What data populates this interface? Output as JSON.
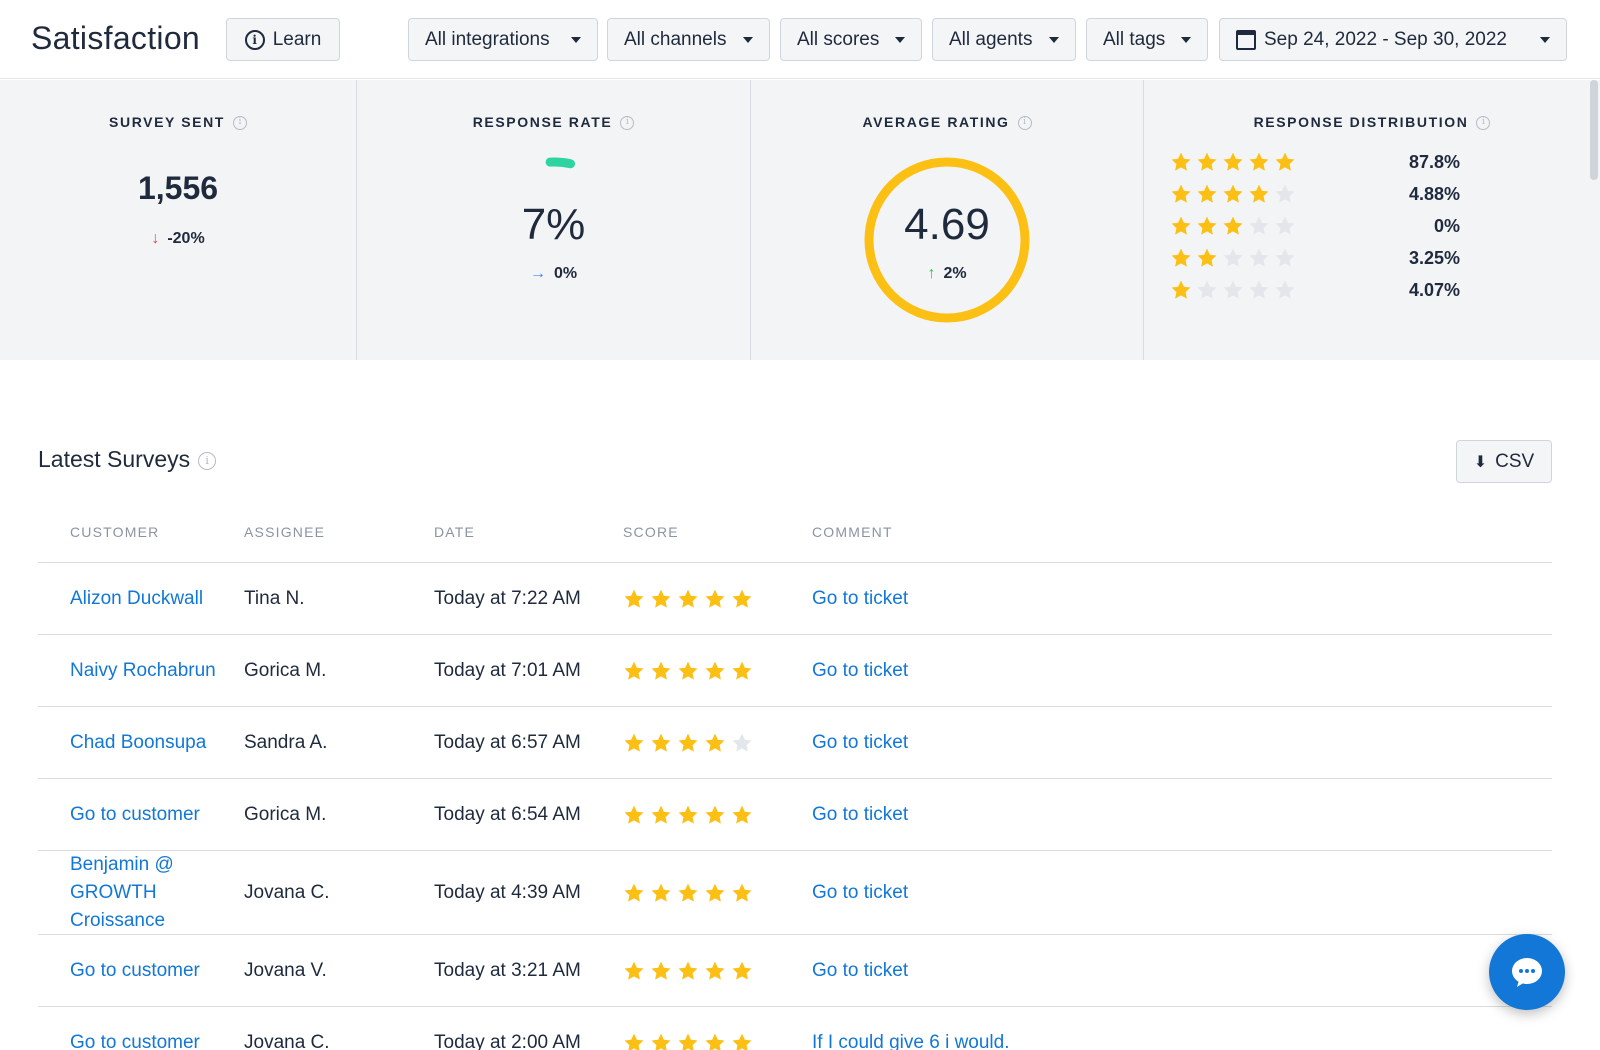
{
  "header": {
    "title": "Satisfaction",
    "learn_label": "Learn",
    "filters": [
      "All integrations",
      "All channels",
      "All scores",
      "All agents",
      "All tags"
    ],
    "date_range": "Sep 24, 2022 - Sep 30, 2022"
  },
  "stats": {
    "survey_sent": {
      "label": "SURVEY SENT",
      "value": "1,556",
      "delta": "-20%",
      "direction": "down"
    },
    "response_rate": {
      "label": "RESPONSE RATE",
      "value": "7%",
      "delta": "0%",
      "direction": "flat",
      "progress_fraction": 0.07
    },
    "average_rating": {
      "label": "AVERAGE RATING",
      "value": "4.69",
      "delta": "2%",
      "direction": "up",
      "progress_fraction": 0.938
    },
    "distribution": {
      "label": "RESPONSE DISTRIBUTION",
      "rows": [
        {
          "stars": 5,
          "pct": "87.8%"
        },
        {
          "stars": 4,
          "pct": "4.88%"
        },
        {
          "stars": 3,
          "pct": "0%"
        },
        {
          "stars": 2,
          "pct": "3.25%"
        },
        {
          "stars": 1,
          "pct": "4.07%"
        }
      ]
    }
  },
  "surveys": {
    "title": "Latest Surveys",
    "csv_label": "CSV",
    "columns": [
      "CUSTOMER",
      "ASSIGNEE",
      "DATE",
      "SCORE",
      "COMMENT"
    ],
    "rows": [
      {
        "customer": "Alizon Duckwall",
        "assignee": "Tina N.",
        "date": "Today at 7:22 AM",
        "score": 5,
        "comment": "Go to ticket"
      },
      {
        "customer": "Naivy Rochabrun",
        "assignee": "Gorica M.",
        "date": "Today at 7:01 AM",
        "score": 5,
        "comment": "Go to ticket"
      },
      {
        "customer": "Chad Boonsupa",
        "assignee": "Sandra A.",
        "date": "Today at 6:57 AM",
        "score": 4,
        "comment": "Go to ticket"
      },
      {
        "customer": "Go to customer",
        "assignee": "Gorica M.",
        "date": "Today at 6:54 AM",
        "score": 5,
        "comment": "Go to ticket"
      },
      {
        "customer": "Benjamin @ GROWTH Croissance",
        "assignee": "Jovana C.",
        "date": "Today at 4:39 AM",
        "score": 5,
        "comment": "Go to ticket"
      },
      {
        "customer": "Go to customer",
        "assignee": "Jovana V.",
        "date": "Today at 3:21 AM",
        "score": 5,
        "comment": "Go to ticket"
      },
      {
        "customer": "Go to customer",
        "assignee": "Jovana C.",
        "date": "Today at 2:00 AM",
        "score": 5,
        "comment": "If I could give 6 i would."
      }
    ]
  },
  "colors": {
    "star_filled": "#fcbf13",
    "star_empty": "#e3e6eb",
    "response_arc": "#2dd4a0",
    "rating_ring": "#fcbf13",
    "link": "#1277d6"
  }
}
